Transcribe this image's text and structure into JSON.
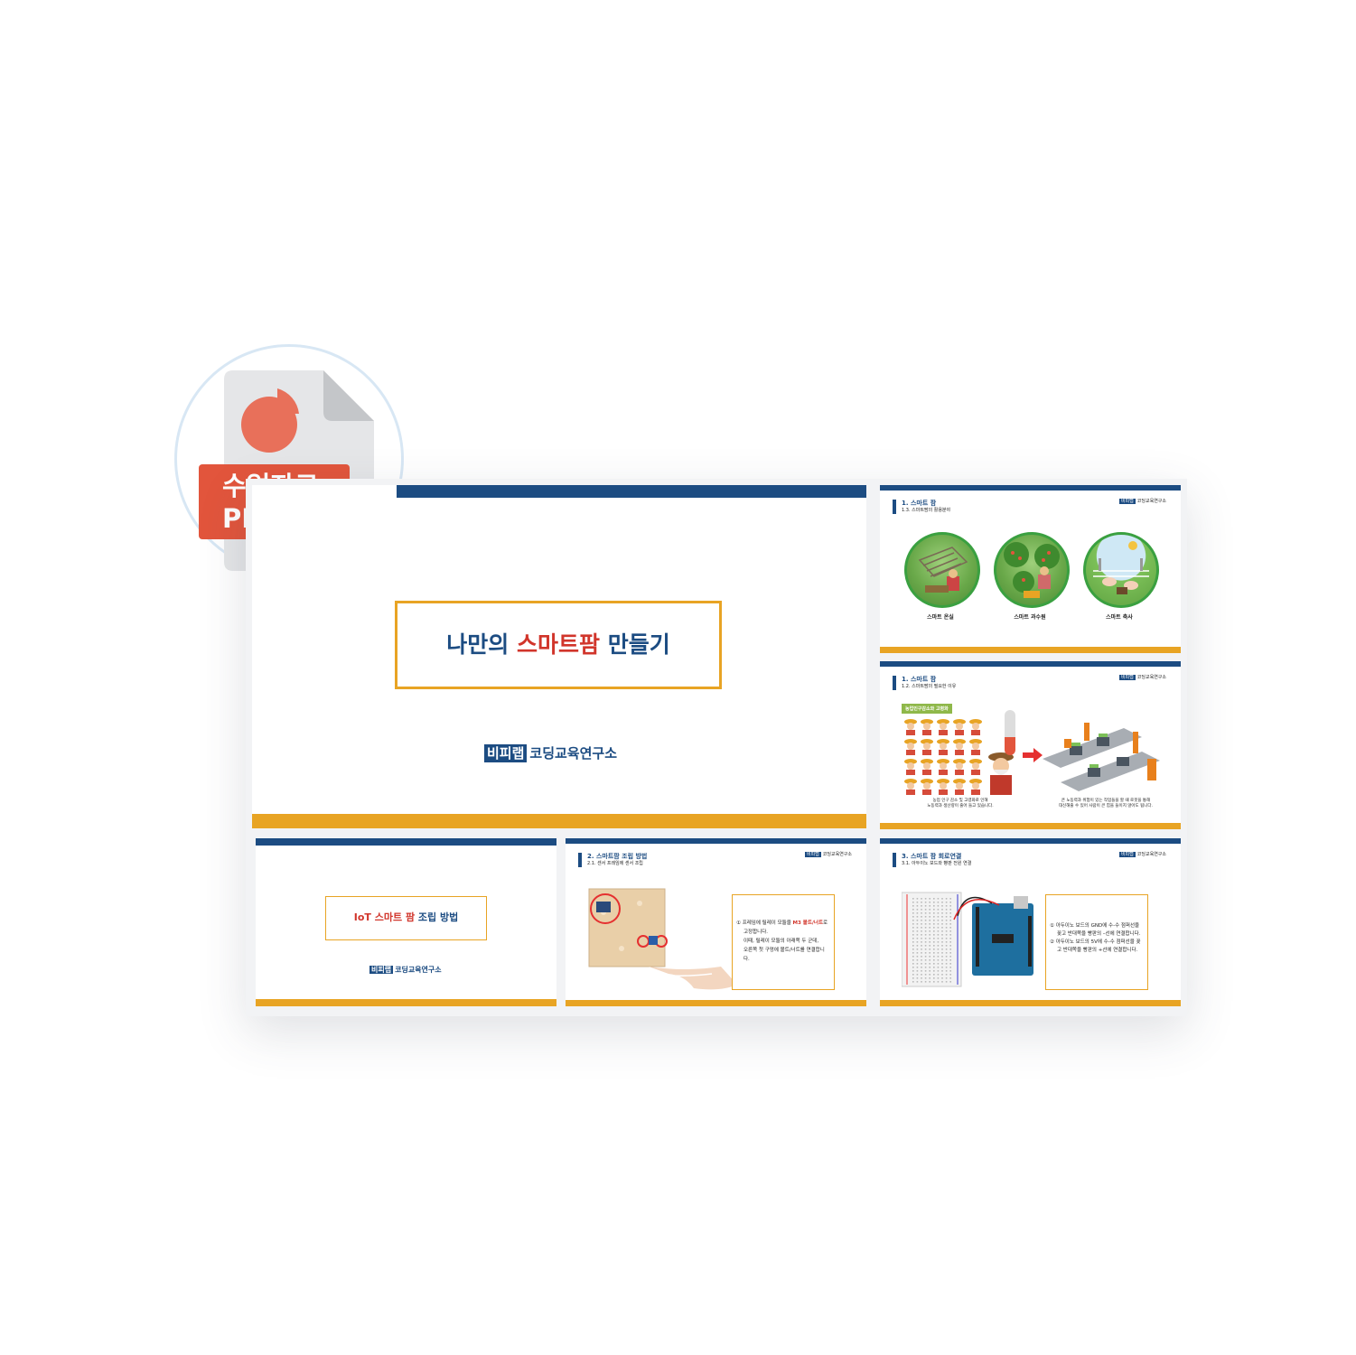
{
  "badge": {
    "line1": "수업자료",
    "line2": "PPT"
  },
  "main_slide": {
    "title_part1": "나만의 ",
    "title_highlight": "스마트팜",
    "title_part2": " 만들기",
    "logo_badge": "비피랩",
    "logo_text": "코딩교육연구소"
  },
  "slide_farm_types": {
    "h1": "1. 스마트 팜",
    "h2": "1.3. 스마트팜의 활용분야",
    "logo_badge": "비피랩",
    "logo_text": "코딩교육연구소",
    "labels": [
      "스마트 온실",
      "스마트 과수원",
      "스마트 축사"
    ]
  },
  "slide_reason": {
    "h1": "1. 스마트 팜",
    "h2": "1.2. 스마트팜의 필요한 이유",
    "logo_badge": "비피랩",
    "logo_text": "코딩교육연구소",
    "tag": "농업인구감소와 고령화",
    "caption_left_1": "농업 인구 감소 및 고령화로 인해",
    "caption_left_2": "노동력과 생산량이 줄어 들고 있습니다.",
    "caption_right_1": "큰 노동력과 위험이 있는 작업들을 할 때 로봇을 통해",
    "caption_right_2": "대신해줄 수 있어 사람이 큰 힘을 들이지 않아도 됩니다."
  },
  "slide_section": {
    "title_part1": "IoT ",
    "title_highlight": "스마트 팜",
    "title_part2": " 조립 방법",
    "logo_badge": "비피랩",
    "logo_text": "코딩교육연구소"
  },
  "slide_assembly": {
    "h1": "2. 스마트팜 조립 방법",
    "h2": "2.1. 센서 프레임에 센서 조립",
    "logo_badge": "비피랩",
    "logo_text": "코딩교육연구소",
    "step_num": "①",
    "line1_a": "프레임에 릴레이 모듈을 ",
    "line1_hl": "M3 볼트/너트",
    "line1_b": "로",
    "line2": "고정합니다.",
    "line3": "이때, 릴레이 모듈의 아래쪽 두 군데,",
    "line4": "오른쪽 첫 구멍에 볼트/너트를 연결합니",
    "line5": "다."
  },
  "slide_circuit": {
    "h1": "3. 스마트 팜 회로연결",
    "h2": "3.1. 아두이노 보드와 빵판 전원 연결",
    "logo_badge": "비피랩",
    "logo_text": "코딩교육연구소",
    "step1_num": "①",
    "step1_a": "아두이노 보드의 GND에 수-수 점퍼선을",
    "step1_b": "꽂고 반대쪽을 빵판의 –선에 연결합니다.",
    "step2_num": "②",
    "step2_a": "아두이노 보드의 5V에 수-수 점퍼선을 꽂",
    "step2_b": "고 반대쪽을 빵판의 +선에 연결합니다."
  },
  "colors": {
    "navy": "#1c4c82",
    "orange": "#e8a424",
    "red": "#d1352b",
    "badge_red": "#e2553c"
  }
}
